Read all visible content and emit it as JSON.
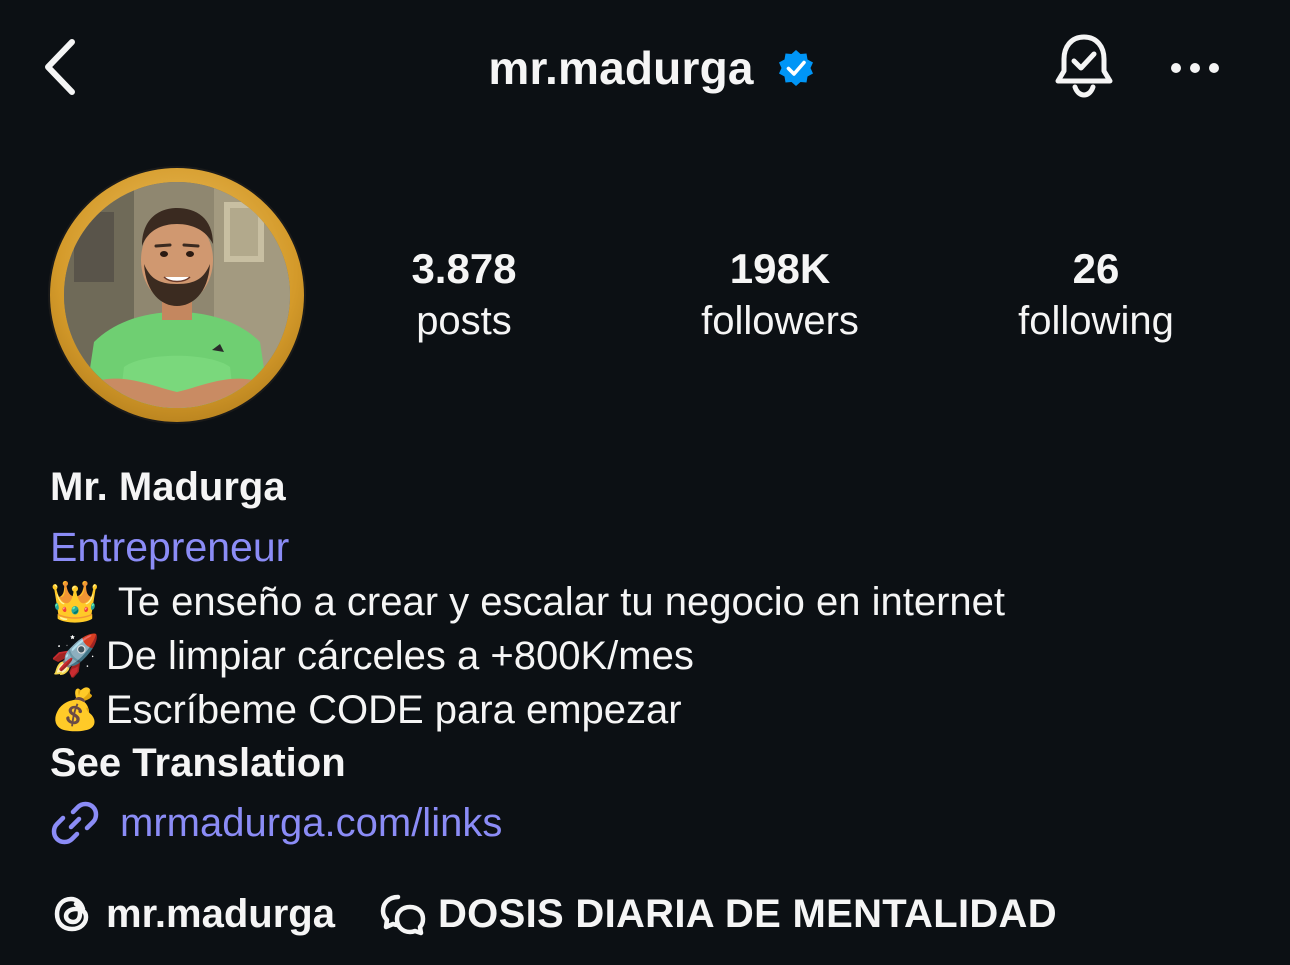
{
  "header": {
    "username": "mr.madurga",
    "verified": true,
    "icons": {
      "back": "chevron-left-icon",
      "verified": "verified-badge-icon",
      "notifications": "bell-check-icon",
      "more": "more-dots-icon"
    }
  },
  "profile": {
    "avatar": "profile-photo",
    "stats": [
      {
        "value": "3.878",
        "label": "posts"
      },
      {
        "value": "198K",
        "label": "followers"
      },
      {
        "value": "26",
        "label": "following"
      }
    ],
    "display_name": "Mr. Madurga",
    "category": "Entrepreneur",
    "bio_lines": [
      {
        "emoji": "👑",
        "text": "Te enseño a crear y escalar tu negocio en internet"
      },
      {
        "emoji": "🚀",
        "text": "De limpiar cárceles a +800K/mes"
      },
      {
        "emoji": "💰",
        "text": "Escríbeme CODE para empezar"
      }
    ],
    "see_translation": "See Translation",
    "link": {
      "icon": "link-icon",
      "text": "mrmadurga.com/links"
    },
    "threads": {
      "icon": "threads-icon",
      "text": "mr.madurga"
    },
    "channel": {
      "icon": "broadcast-channel-icon",
      "text": "DOSIS DIARIA DE MENTALIDAD"
    }
  },
  "colors": {
    "background": "#0c1014",
    "text": "#f5f5f5",
    "link": "#8b8cf6",
    "verified": "#0095f6",
    "ring": "#d49a2a"
  }
}
